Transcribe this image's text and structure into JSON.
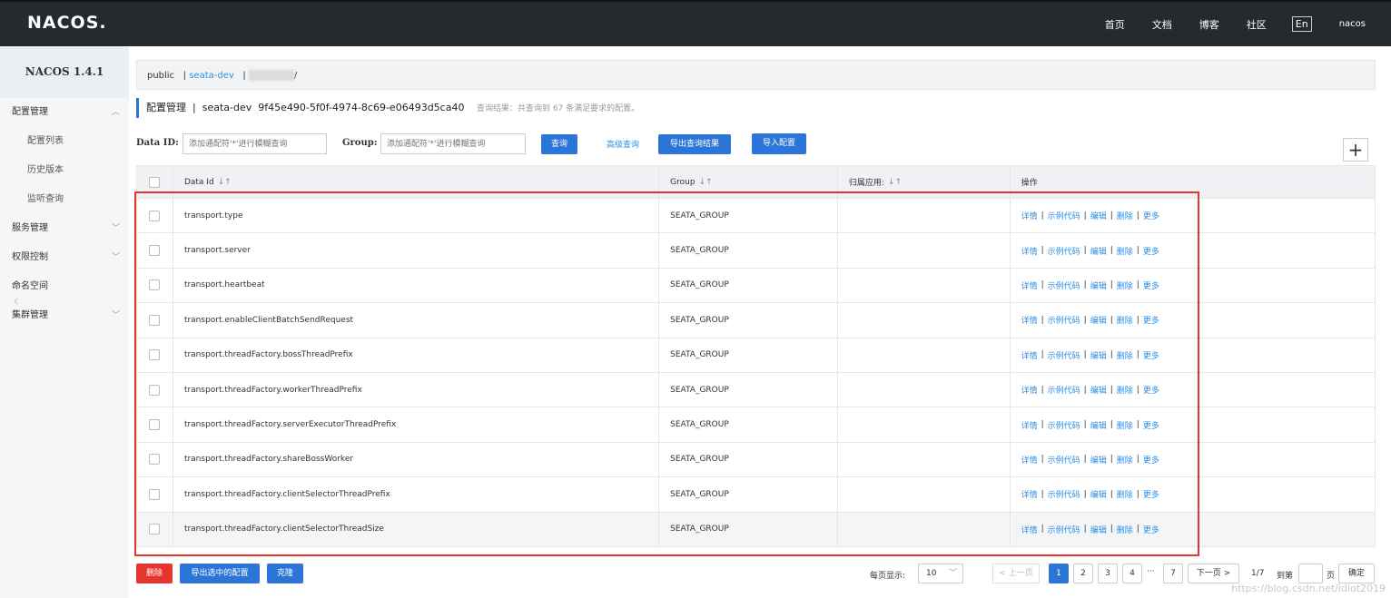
{
  "header": {
    "logo": "NACOS.",
    "nav": [
      "首页",
      "文档",
      "博客",
      "社区"
    ],
    "lang": "En",
    "user": "nacos"
  },
  "sidebar": {
    "version": "NACOS 1.4.1",
    "items": [
      {
        "label": "配置管理",
        "chevron": "︿"
      },
      {
        "label": "配置列表"
      },
      {
        "label": "历史版本"
      },
      {
        "label": "监听查询"
      },
      {
        "label": "服务管理",
        "chevron": "﹀"
      },
      {
        "label": "权限控制",
        "chevron": "﹀"
      },
      {
        "label": "命名空间"
      },
      {
        "label": "集群管理",
        "chevron": "﹀"
      }
    ]
  },
  "breadcrumb": {
    "public": "public",
    "sep": "|",
    "seata": "seata-dev",
    "tail": "/"
  },
  "headline": {
    "title": "配置管理",
    "sep": "|",
    "namespace": "seata-dev",
    "namespace_id": "9f45e490-5f0f-4974-8c69-e06493d5ca40",
    "result": "查询结果：共查询到 67 条满足要求的配置。"
  },
  "filter": {
    "dataid_label": "Data ID:",
    "dataid_placeholder": "添加通配符'*'进行模糊查询",
    "group_label": "Group:",
    "group_placeholder": "添加通配符'*'进行模糊查询",
    "query": "查询",
    "advanced": "高级查询",
    "export": "导出查询结果",
    "import": "导入配置",
    "plus": "+"
  },
  "table": {
    "headers": [
      "Data Id",
      "Group",
      "归属应用:",
      "操作"
    ],
    "sort_icon": "↓↑",
    "rows": [
      {
        "dataId": "transport.type",
        "group": "SEATA_GROUP",
        "app": ""
      },
      {
        "dataId": "transport.server",
        "group": "SEATA_GROUP",
        "app": ""
      },
      {
        "dataId": "transport.heartbeat",
        "group": "SEATA_GROUP",
        "app": ""
      },
      {
        "dataId": "transport.enableClientBatchSendRequest",
        "group": "SEATA_GROUP",
        "app": ""
      },
      {
        "dataId": "transport.threadFactory.bossThreadPrefix",
        "group": "SEATA_GROUP",
        "app": ""
      },
      {
        "dataId": "transport.threadFactory.workerThreadPrefix",
        "group": "SEATA_GROUP",
        "app": ""
      },
      {
        "dataId": "transport.threadFactory.serverExecutorThreadPrefix",
        "group": "SEATA_GROUP",
        "app": ""
      },
      {
        "dataId": "transport.threadFactory.shareBossWorker",
        "group": "SEATA_GROUP",
        "app": ""
      },
      {
        "dataId": "transport.threadFactory.clientSelectorThreadPrefix",
        "group": "SEATA_GROUP",
        "app": ""
      },
      {
        "dataId": "transport.threadFactory.clientSelectorThreadSize",
        "group": "SEATA_GROUP",
        "app": ""
      }
    ],
    "ops": [
      "详情",
      "示例代码",
      "编辑",
      "删除",
      "更多"
    ]
  },
  "footer": {
    "delete": "删除",
    "export_selected": "导出选中的配置",
    "clone": "克隆",
    "page_size_label": "每页显示:",
    "page_size": "10",
    "prev": "< 上一页",
    "pages": [
      "1",
      "2",
      "3",
      "4"
    ],
    "ellipsis": "···",
    "last": "7",
    "next": "下一页 >",
    "page_info": "1/7",
    "goto": "到第",
    "page_unit": "页",
    "confirm": "确定"
  },
  "watermark": "https://blog.csdn.net/idiot2019",
  "colors": {
    "primary": "#2b75d8",
    "danger": "#e8342e",
    "topbar": "#252a2f"
  }
}
